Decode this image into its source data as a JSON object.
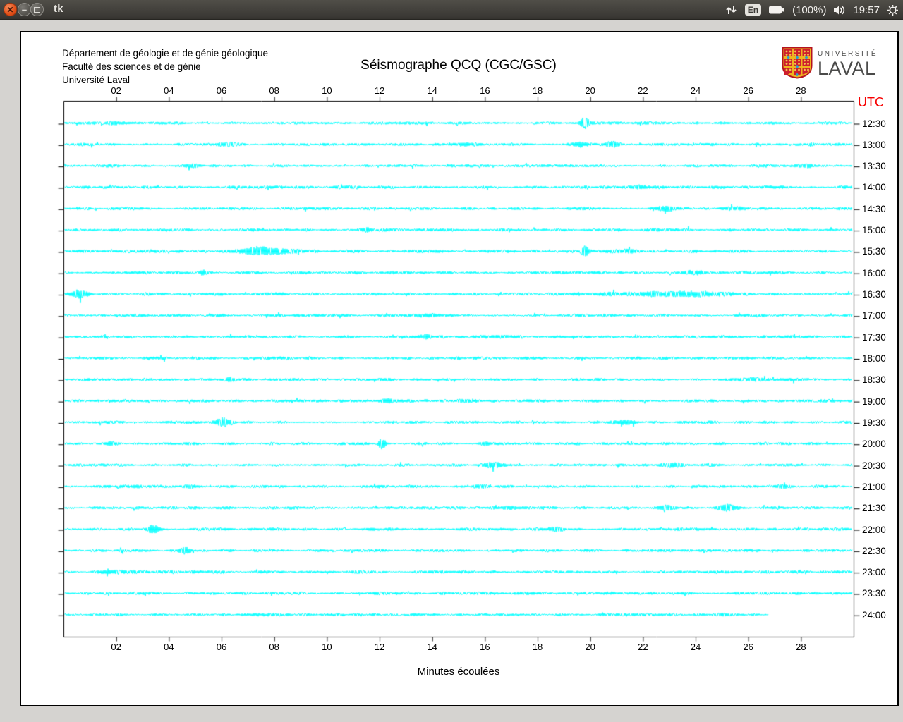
{
  "window": {
    "title": "tk",
    "close_glyph": "✕",
    "minimize_glyph": "–"
  },
  "system_tray": {
    "keyboard_indicator": "En",
    "battery_label": "(100%)",
    "clock": "19:57"
  },
  "document": {
    "header_lines": [
      "Département de géologie et de génie géologique",
      "Faculté des sciences et de génie",
      "Université Laval"
    ],
    "title": "Séismographe QCQ (CGC/GSC)",
    "logo": {
      "line1": "UNIVERSITÉ",
      "line2": "LAVAL"
    }
  },
  "chart_data": {
    "type": "line",
    "subtype": "helicorder-seismogram",
    "title": "Séismographe QCQ (CGC/GSC)",
    "xlabel": "Minutes écoulées",
    "right_axis_title": "UTC",
    "x_range": [
      0,
      30
    ],
    "x_tick_minutes": [
      2,
      4,
      6,
      8,
      10,
      12,
      14,
      16,
      18,
      20,
      22,
      24,
      26,
      28
    ],
    "x_tick_labels": [
      "02",
      "04",
      "06",
      "08",
      "10",
      "12",
      "14",
      "16",
      "18",
      "20",
      "22",
      "24",
      "26",
      "28"
    ],
    "grid": false,
    "colors": {
      "trace": "#00ffff",
      "axis": "#000000",
      "right_axis_title": "#f70000"
    },
    "row_interval_minutes": 30,
    "rows": [
      {
        "utc": "12:30",
        "end_minute": 30,
        "events": [
          [
            19.8,
            9,
            0.12
          ],
          [
            2.0,
            1.5,
            0.3
          ]
        ]
      },
      {
        "utc": "13:00",
        "end_minute": 30,
        "events": [
          [
            6.3,
            2.5,
            0.3
          ],
          [
            15.2,
            2.5,
            0.25
          ],
          [
            19.6,
            3.5,
            0.15
          ],
          [
            20.8,
            3.5,
            0.2
          ],
          [
            28.4,
            2.5,
            0.1
          ]
        ]
      },
      {
        "utc": "13:30",
        "end_minute": 30,
        "events": [
          [
            4.8,
            2,
            0.3
          ],
          [
            28.3,
            2.5,
            0.2
          ]
        ]
      },
      {
        "utc": "14:00",
        "end_minute": 30,
        "events": [
          [
            10.5,
            2,
            0.2
          ],
          [
            21.8,
            2.5,
            0.2
          ]
        ]
      },
      {
        "utc": "14:30",
        "end_minute": 30,
        "events": [
          [
            22.8,
            2.5,
            0.3
          ],
          [
            25.5,
            2,
            0.3
          ]
        ]
      },
      {
        "utc": "15:00",
        "end_minute": 30,
        "events": [
          [
            11.5,
            2,
            0.2
          ]
        ]
      },
      {
        "utc": "15:30",
        "end_minute": 30,
        "events": [
          [
            7.5,
            5.5,
            0.45
          ],
          [
            8.4,
            2.5,
            0.5
          ],
          [
            19.8,
            8.5,
            0.1
          ],
          [
            21.3,
            2.5,
            0.4
          ]
        ]
      },
      {
        "utc": "16:00",
        "end_minute": 30,
        "events": [
          [
            5.3,
            3,
            0.12
          ],
          [
            24.0,
            2.5,
            0.3
          ]
        ]
      },
      {
        "utc": "16:30",
        "end_minute": 30,
        "events": [
          [
            0.6,
            5.5,
            0.25
          ],
          [
            22.0,
            2,
            1.5
          ],
          [
            24.0,
            2,
            1.0
          ]
        ]
      },
      {
        "utc": "17:00",
        "end_minute": 30,
        "events": [
          [
            14.0,
            1.5,
            0.3
          ]
        ]
      },
      {
        "utc": "17:30",
        "end_minute": 30,
        "events": [
          [
            13.8,
            2.5,
            0.15
          ],
          [
            16.5,
            2,
            0.2
          ]
        ]
      },
      {
        "utc": "18:00",
        "end_minute": 30,
        "events": []
      },
      {
        "utc": "18:30",
        "end_minute": 30,
        "events": [
          [
            6.3,
            2,
            0.2
          ],
          [
            26.0,
            2,
            0.3
          ]
        ]
      },
      {
        "utc": "19:00",
        "end_minute": 30,
        "events": [
          [
            12.3,
            2.5,
            0.2
          ],
          [
            15.3,
            2,
            0.2
          ]
        ]
      },
      {
        "utc": "19:30",
        "end_minute": 30,
        "events": [
          [
            6.1,
            5.5,
            0.25
          ],
          [
            21.3,
            2.5,
            0.3
          ]
        ]
      },
      {
        "utc": "20:00",
        "end_minute": 30,
        "events": [
          [
            12.1,
            7.5,
            0.1
          ],
          [
            1.8,
            2.5,
            0.2
          ],
          [
            16.0,
            2,
            0.2
          ]
        ]
      },
      {
        "utc": "20:30",
        "end_minute": 30,
        "events": [
          [
            16.2,
            3,
            0.3
          ],
          [
            23.2,
            2.5,
            0.3
          ]
        ]
      },
      {
        "utc": "21:00",
        "end_minute": 30,
        "events": [
          [
            4.8,
            2.5,
            0.2
          ],
          [
            15.9,
            2.5,
            0.2
          ],
          [
            27.3,
            2.5,
            0.2
          ]
        ]
      },
      {
        "utc": "21:30",
        "end_minute": 30,
        "events": [
          [
            17.0,
            2.5,
            0.3
          ],
          [
            22.9,
            3.5,
            0.25
          ],
          [
            25.2,
            4.5,
            0.3
          ]
        ]
      },
      {
        "utc": "22:00",
        "end_minute": 30,
        "events": [
          [
            3.4,
            5.5,
            0.2
          ],
          [
            18.7,
            2.5,
            0.25
          ]
        ]
      },
      {
        "utc": "22:30",
        "end_minute": 30,
        "events": [
          [
            4.6,
            4.5,
            0.15
          ]
        ]
      },
      {
        "utc": "23:00",
        "end_minute": 30,
        "events": [
          [
            2.0,
            2,
            0.3
          ]
        ]
      },
      {
        "utc": "23:30",
        "end_minute": 30,
        "events": [
          [
            12.0,
            1.5,
            0.3
          ]
        ]
      },
      {
        "utc": "24:00",
        "end_minute": 26.8,
        "events": [
          [
            25.0,
            2,
            0.2
          ]
        ]
      }
    ]
  }
}
